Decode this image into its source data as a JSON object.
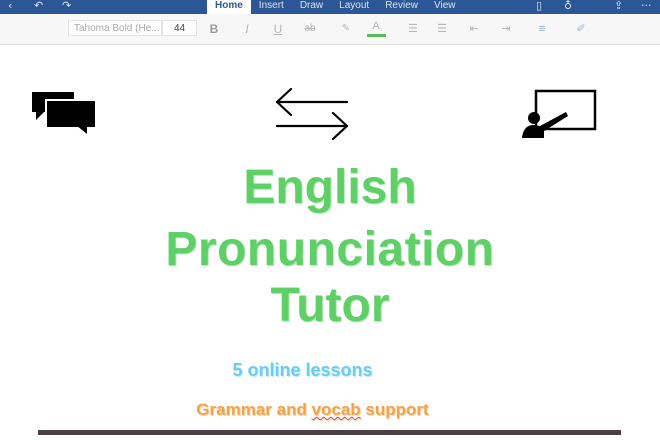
{
  "toolbar": {
    "tabs": [
      {
        "label": "Home",
        "active": true
      },
      {
        "label": "Insert",
        "active": false
      },
      {
        "label": "Draw",
        "active": false
      },
      {
        "label": "Layout",
        "active": false
      },
      {
        "label": "Review",
        "active": false
      },
      {
        "label": "View",
        "active": false
      }
    ],
    "font_name": "Tahoma Bold (He...",
    "font_size": "44",
    "bold": "B",
    "italic": "I",
    "underline": "U",
    "strike": "ab",
    "font_color": "A",
    "highlight_color": "#5cb85c",
    "brand_color": "#2b5797"
  },
  "icons": {
    "back": "chevron-left-icon",
    "undo": "undo-icon",
    "redo": "redo-icon",
    "phone": "phone-icon",
    "lightbulb": "lightbulb-icon",
    "share": "share-icon",
    "more": "more-icon",
    "conversation": "speech-bubbles-icon",
    "arrows": "left-right-arrows-icon",
    "presenter": "presenter-screen-icon"
  },
  "document": {
    "title_lines": [
      "English",
      "Pronunciation",
      "Tutor"
    ],
    "subtitle": "5 online lessons",
    "tagline_before": "Grammar and ",
    "tagline_misspelled": "vocab",
    "tagline_after": " support",
    "colors": {
      "title": "#5fd067",
      "subtitle": "#6ecbf0",
      "tagline": "#f4a24a",
      "rule": "#4b3f43"
    }
  }
}
